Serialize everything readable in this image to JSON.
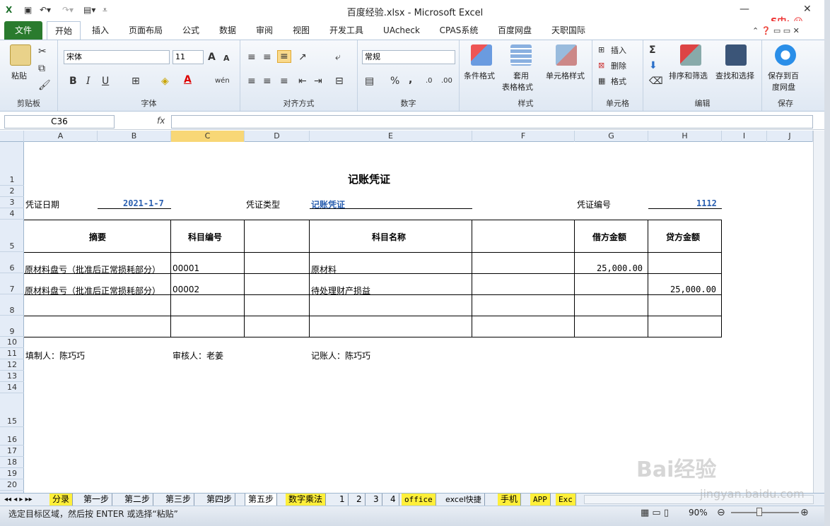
{
  "titlebar": {
    "title": "百度经验.xlsx - Microsoft Excel"
  },
  "ribbon_tabs": {
    "file": "文件",
    "items": [
      "开始",
      "插入",
      "页面布局",
      "公式",
      "数据",
      "审阅",
      "视图",
      "开发工具",
      "UAcheck",
      "CPAS系统",
      "百度网盘",
      "天职国际"
    ]
  },
  "ribbon": {
    "clipboard": {
      "paste": "粘贴",
      "label": "剪贴板"
    },
    "font": {
      "name": "宋体",
      "size": "11",
      "label": "字体",
      "bold": "B",
      "italic": "I",
      "underline": "U",
      "grow": "A",
      "shrink": "A",
      "wen": "wén"
    },
    "align": {
      "label": "对齐方式"
    },
    "number": {
      "format": "常规",
      "label": "数字",
      "percent": "%",
      "comma": ","
    },
    "styles": {
      "cond": "条件格式",
      "table": "套用",
      "table2": "表格格式",
      "cell": "单元格样式",
      "label": "样式"
    },
    "cells": {
      "insert": "插入",
      "delete": "删除",
      "format": "格式",
      "label": "单元格"
    },
    "edit": {
      "sum": "Σ",
      "sort": "排序和筛选",
      "find": "查找和选择",
      "label": "编辑"
    },
    "save": {
      "save": "保存到百",
      "save2": "度网盘",
      "label": "保存"
    }
  },
  "formula": {
    "namebox": "C36",
    "fx": "fx",
    "value": ""
  },
  "columns": [
    "A",
    "B",
    "C",
    "D",
    "E",
    "F",
    "G",
    "H",
    "I",
    "J"
  ],
  "rows": [
    "1",
    "2",
    "3",
    "4",
    "5",
    "6",
    "7",
    "8",
    "9",
    "10",
    "11",
    "12",
    "13",
    "14",
    "15",
    "16",
    "17",
    "18",
    "19",
    "20"
  ],
  "voucher": {
    "title": "记账凭证",
    "date_label": "凭证日期",
    "date_value": "2021-1-7",
    "type_label": "凭证类型",
    "type_value": "记账凭证",
    "no_label": "凭证编号",
    "no_value": "1112",
    "headers": {
      "summary": "摘要",
      "code": "科目编号",
      "name": "科目名称",
      "debit": "借方金额",
      "credit": "贷方金额"
    },
    "lines": [
      {
        "summary": "原材料盘亏（批准后正常损耗部分）",
        "code": "00001",
        "name": "原材料",
        "debit": "25,000.00",
        "credit": ""
      },
      {
        "summary": "原材料盘亏（批准后正常损耗部分）",
        "code": "00002",
        "name": "待处理财产损益",
        "debit": "",
        "credit": "25,000.00"
      }
    ],
    "maker": "填制人：陈巧巧",
    "reviewer": "审核人：老姜",
    "bookkeeper": "记账人：陈巧巧"
  },
  "sheet_tabs": [
    "分录",
    "第一步",
    "第二步",
    "第三步",
    "第四步",
    "第五步",
    "数字乘法",
    "1",
    "2",
    "3",
    "4",
    "office",
    "excel快捷",
    "手机",
    "APP",
    "Exc"
  ],
  "status": {
    "text": "选定目标区域，然后按 ENTER 或选择“粘贴”",
    "zoom": "90%"
  },
  "watermark": {
    "brand": "Bai经验",
    "url": "jingyan.baidu.com"
  }
}
